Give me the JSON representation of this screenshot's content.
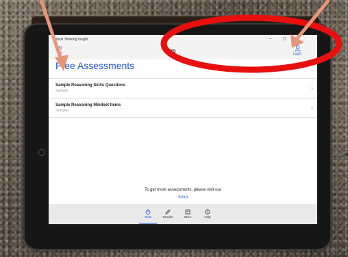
{
  "window": {
    "app_title": "Critical Thinking Insight",
    "page_header": "TS",
    "minimize": "–",
    "maximize": "☐",
    "close": "✕"
  },
  "header": {
    "back_label": "Sel",
    "login_label": "Login"
  },
  "main": {
    "heading": "Free Assessments",
    "items": [
      {
        "title": "Sample Reasoning Skills Questions",
        "subtitle": "Sample"
      },
      {
        "title": "Sample Reasoning Mindset Items",
        "subtitle": "Sample"
      }
    ],
    "promo_text": "To get more assessments, please visit our",
    "store_link": "Store"
  },
  "bottom_nav": {
    "items": [
      {
        "label": "Tests",
        "icon": "stopwatch-icon"
      },
      {
        "label": "Results",
        "icon": "pencil-icon"
      },
      {
        "label": "Store",
        "icon": "store-icon"
      },
      {
        "label": "Help",
        "icon": "help-icon"
      }
    ],
    "active": "Tests"
  },
  "colors": {
    "accent": "#1e5bd6",
    "annotation_red": "#e8100f",
    "arrow": "#e8967a"
  }
}
